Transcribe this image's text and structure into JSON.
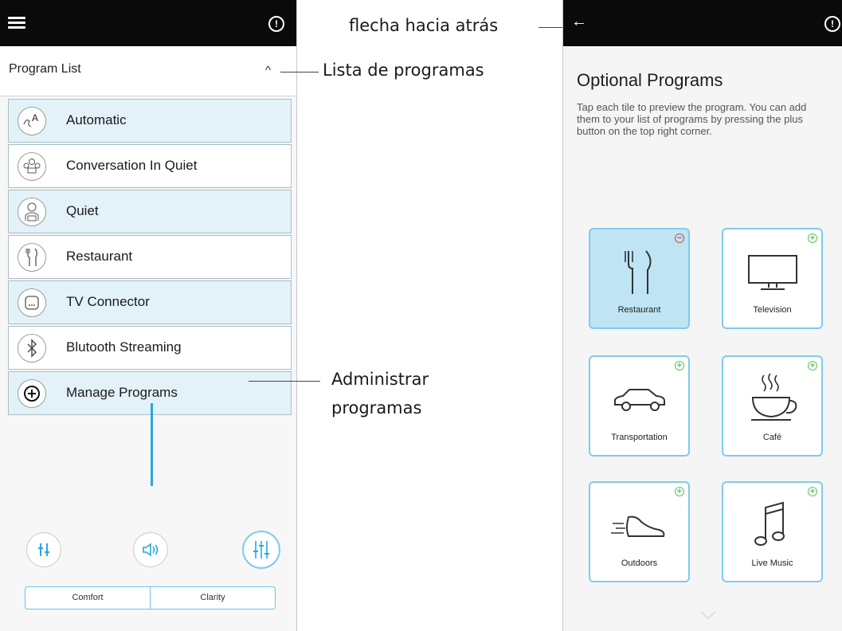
{
  "left_screen": {
    "program_list_title": "Program List",
    "collapse_chevron": "^",
    "info_symbol": "!",
    "programs": [
      {
        "label": "Automatic",
        "icon": "automatic-icon"
      },
      {
        "label": "Conversation In Quiet",
        "icon": "conversation-group-icon"
      },
      {
        "label": "Quiet",
        "icon": "quiet-person-icon"
      },
      {
        "label": "Restaurant",
        "icon": "fork-knife-icon"
      },
      {
        "label": "TV Connector",
        "icon": "tv-connector-icon"
      },
      {
        "label": "Blutooth Streaming",
        "icon": "bluetooth-icon"
      },
      {
        "label": "Manage Programs",
        "icon": "plus-circle-icon"
      }
    ],
    "controls": {
      "mode_left": "Comfort",
      "mode_right": "Clarity"
    },
    "colors": {
      "accent": "#29a8e0",
      "item_highlight": "#e3f2f8",
      "topbar": "#0a0a0a"
    }
  },
  "annotations": {
    "back_arrow": "flecha hacia atrás",
    "program_list": "Lista de programas",
    "manage_line1": "Administrar",
    "manage_line2": "programas"
  },
  "right_screen": {
    "back_symbol": "←",
    "info_symbol": "!",
    "title": "Optional Programs",
    "description": "Tap each tile to preview the program. You can add them to your list of programs by pressing the plus button on the top right corner.",
    "tiles": [
      {
        "label": "Restaurant",
        "icon": "fork-knife-icon",
        "badge": "remove",
        "selected": true
      },
      {
        "label": "Television",
        "icon": "television-icon",
        "badge": "add",
        "selected": false
      },
      {
        "label": "Transportation",
        "icon": "car-icon",
        "badge": "add",
        "selected": false
      },
      {
        "label": "Café",
        "icon": "coffee-cup-icon",
        "badge": "add",
        "selected": false
      },
      {
        "label": "Outdoors",
        "icon": "running-shoe-icon",
        "badge": "add",
        "selected": false
      },
      {
        "label": "Live Music",
        "icon": "music-note-icon",
        "badge": "add",
        "selected": false
      }
    ],
    "badge_add_symbol": "+",
    "badge_remove_symbol": "−",
    "colors": {
      "tile_border": "#7fcbed",
      "tile_selected": "#bfe4f4",
      "add": "#5cc45c",
      "remove": "#e04848"
    }
  }
}
